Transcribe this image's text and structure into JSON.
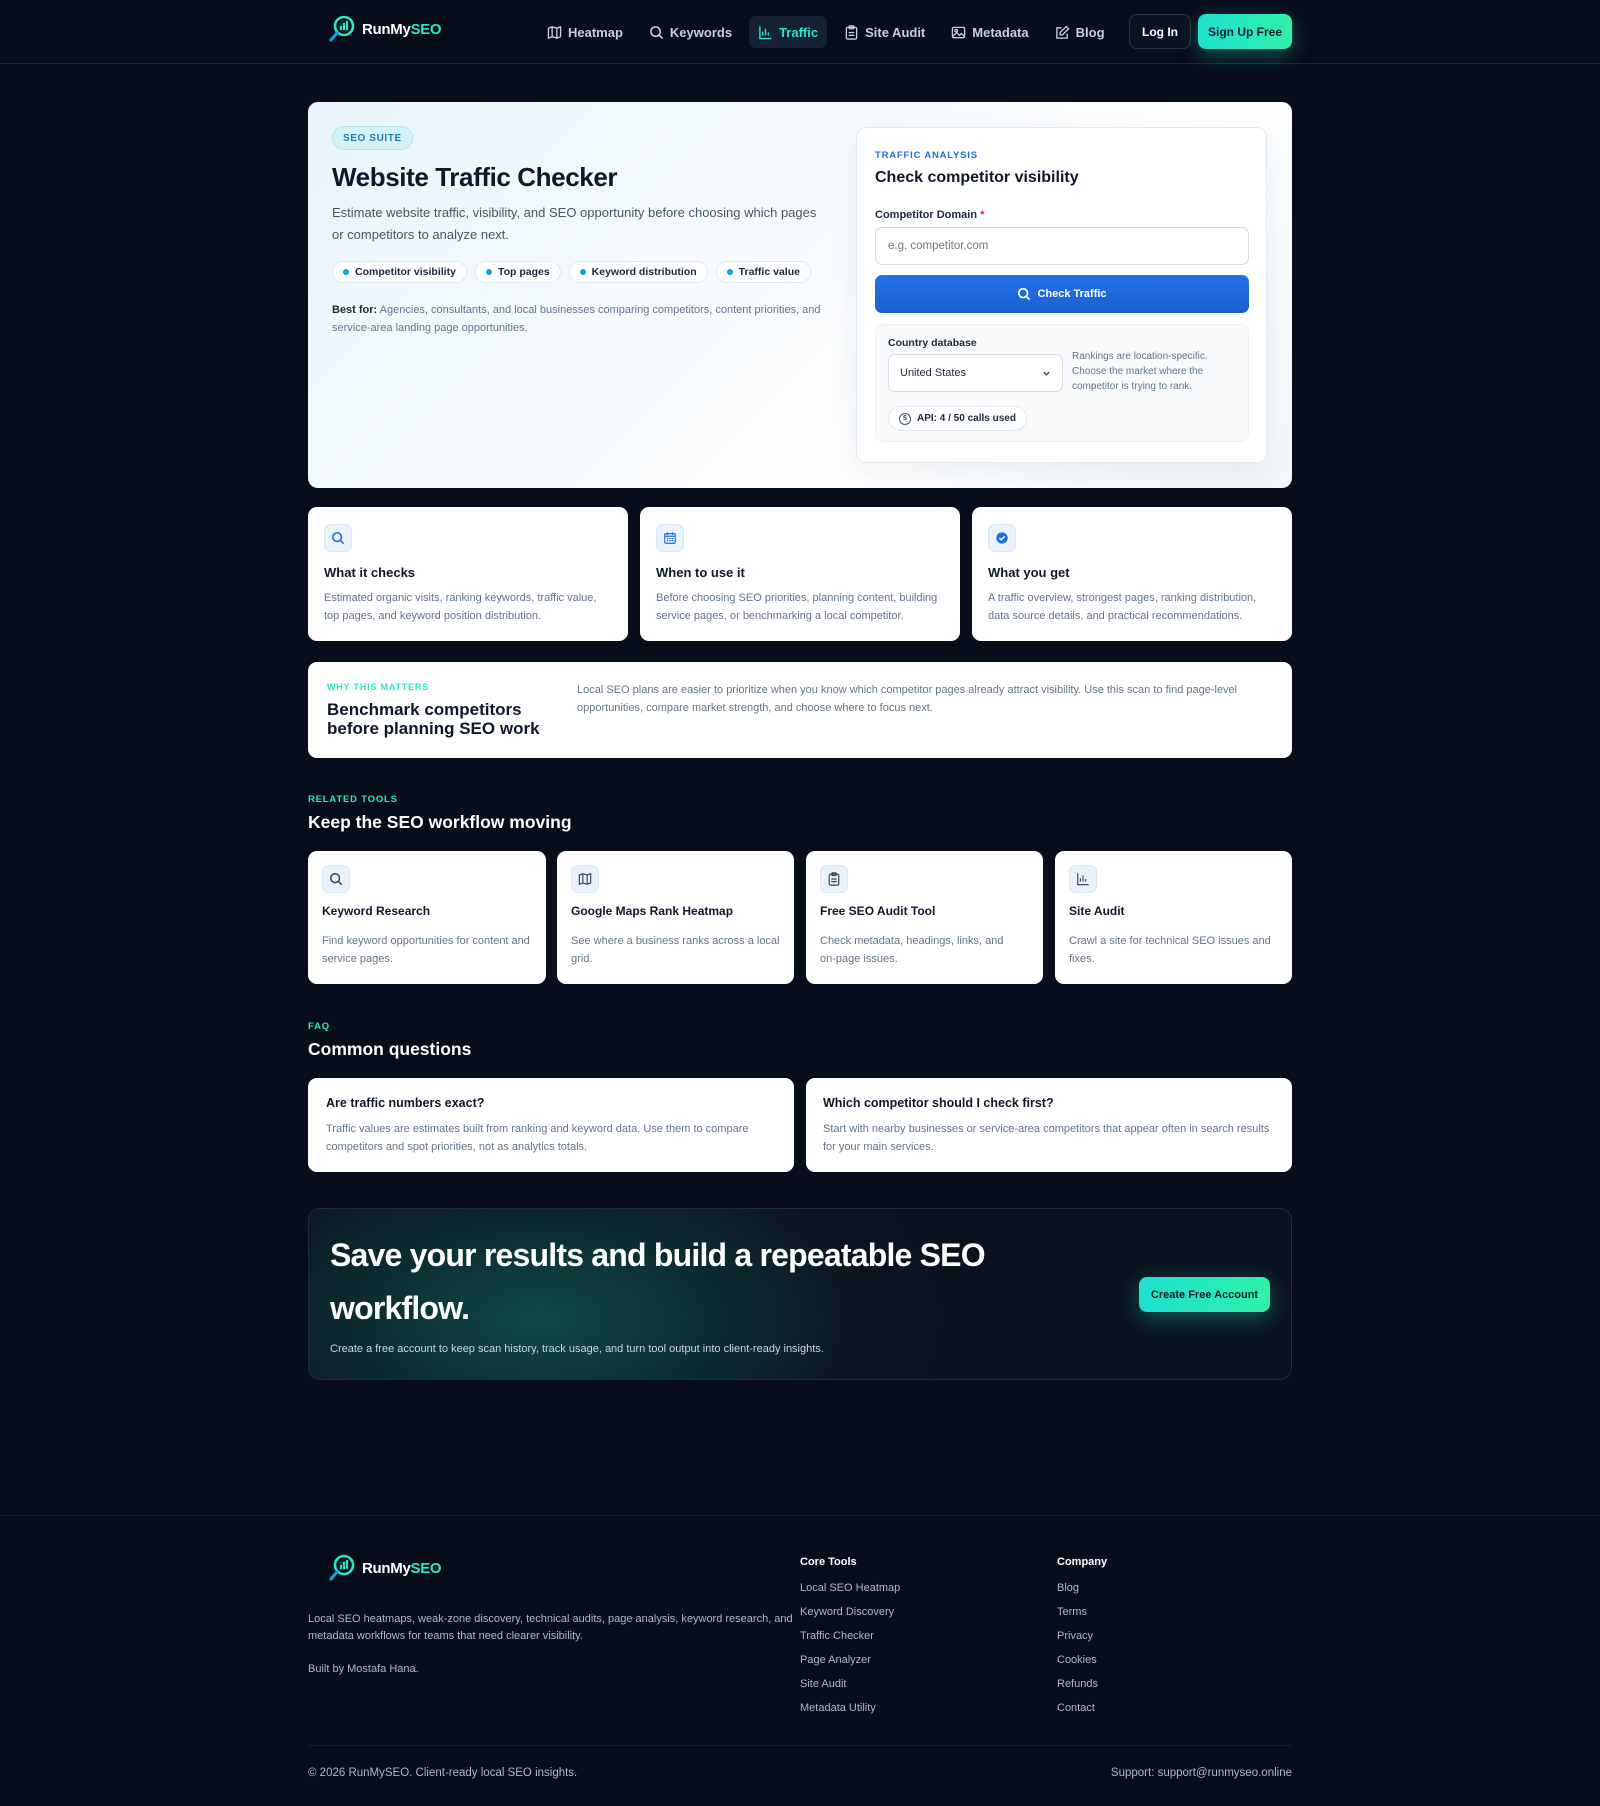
{
  "brand": {
    "name_part1": "RunMy",
    "name_part2": "SEO"
  },
  "nav": [
    {
      "label": "Heatmap",
      "icon": "map-icon"
    },
    {
      "label": "Keywords",
      "icon": "search-icon"
    },
    {
      "label": "Traffic",
      "icon": "chart-icon",
      "active": true
    },
    {
      "label": "Site Audit",
      "icon": "clipboard-icon"
    },
    {
      "label": "Metadata",
      "icon": "image-icon"
    },
    {
      "label": "Blog",
      "icon": "edit-icon"
    }
  ],
  "header": {
    "login_label": "Log In",
    "signup_label": "Sign Up Free"
  },
  "hero": {
    "badge": "SEO SUITE",
    "title": "Website Traffic Checker",
    "description": "Estimate website traffic, visibility, and SEO opportunity before choosing which pages or competitors to analyze next.",
    "chips": [
      "Competitor visibility",
      "Top pages",
      "Keyword distribution",
      "Traffic value"
    ],
    "best_for_label": "Best for:",
    "best_for_text": " Agencies, consultants, and local businesses comparing competitors, content priorities, and service-area landing page opportunities."
  },
  "panel": {
    "kicker": "TRAFFIC ANALYSIS",
    "title": "Check competitor visibility",
    "field_label": "Competitor Domain",
    "required_mark": "*",
    "field_placeholder": "e.g. competitor.com",
    "button_label": "Check Traffic",
    "country_label": "Country database",
    "country_value": "United States",
    "country_note": "Rankings are location-specific. Choose the market where the competitor is trying to rank.",
    "api_usage": "API: 4 / 50 calls used",
    "coin_symbol": "$"
  },
  "info_cards": [
    {
      "title": "What it checks",
      "text": "Estimated organic visits, ranking keywords, traffic value, top pages, and keyword position distribution.",
      "icon": "search-icon"
    },
    {
      "title": "When to use it",
      "text": "Before choosing SEO priorities, planning content, building service pages, or benchmarking a local competitor.",
      "icon": "calendar-icon"
    },
    {
      "title": "What you get",
      "text": "A traffic overview, strongest pages, ranking distribution, data source details, and practical recommendations.",
      "icon": "check-circle-icon"
    }
  ],
  "why": {
    "kicker": "WHY THIS MATTERS",
    "title": "Benchmark competitors before planning SEO work",
    "text": "Local SEO plans are easier to prioritize when you know which competitor pages already attract visibility. Use this scan to find page-level opportunities, compare market strength, and choose where to focus next."
  },
  "related": {
    "kicker": "RELATED TOOLS",
    "title": "Keep the SEO workflow moving",
    "items": [
      {
        "title": "Keyword Research",
        "text": "Find keyword opportunities for content and service pages.",
        "icon": "search-icon"
      },
      {
        "title": "Google Maps Rank Heatmap",
        "text": "See where a business ranks across a local grid.",
        "icon": "map-icon"
      },
      {
        "title": "Free SEO Audit Tool",
        "text": "Check metadata, headings, links, and on-page issues.",
        "icon": "clipboard-icon"
      },
      {
        "title": "Site Audit",
        "text": "Crawl a site for technical SEO issues and fixes.",
        "icon": "chart-icon"
      }
    ]
  },
  "faq": {
    "kicker": "FAQ",
    "title": "Common questions",
    "items": [
      {
        "q": "Are traffic numbers exact?",
        "a": "Traffic values are estimates built from ranking and keyword data. Use them to compare competitors and spot priorities, not as analytics totals."
      },
      {
        "q": "Which competitor should I check first?",
        "a": "Start with nearby businesses or service-area competitors that appear often in search results for your main services."
      }
    ]
  },
  "cta": {
    "title": "Save your results and build a repeatable SEO workflow.",
    "text": "Create a free account to keep scan history, track usage, and turn tool output into client-ready insights.",
    "button_label": "Create Free Account"
  },
  "footer": {
    "description": "Local SEO heatmaps, weak-zone discovery, technical audits, page analysis, keyword research, and metadata workflows for teams that need clearer visibility.",
    "built_by": "Built by Mostafa Hana.",
    "core_tools_title": "Core Tools",
    "core_tools": [
      "Local SEO Heatmap",
      "Keyword Discovery",
      "Traffic Checker",
      "Page Analyzer",
      "Site Audit",
      "Metadata Utility"
    ],
    "company_title": "Company",
    "company": [
      "Blog",
      "Terms",
      "Privacy",
      "Cookies",
      "Refunds",
      "Contact"
    ],
    "copyright": "© 2026 RunMySEO. Client-ready local SEO insights.",
    "support": "Support: support@runmyseo.online"
  },
  "colors": {
    "accent": "#2ee6c3",
    "primary": "#1d6fd8",
    "background": "#070d1a"
  }
}
